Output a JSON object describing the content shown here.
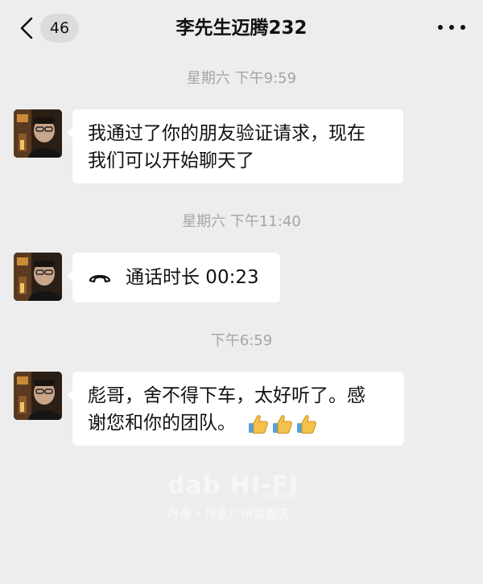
{
  "header": {
    "back_label": "<",
    "unread_count": "46",
    "title": "李先生迈腾232",
    "more_icon": "more-dots-icon"
  },
  "messages": [
    {
      "timestamp": "星期六 下午9:59",
      "type": "text",
      "lines": [
        "我通过了你的朋友验证请求，现在",
        "我们可以开始聊天了"
      ]
    },
    {
      "timestamp": "星期六 下午11:40",
      "type": "call",
      "text": "通话时长 00:23",
      "icon": "phone-hangup-icon"
    },
    {
      "timestamp": "下午6:59",
      "type": "text",
      "lines": [
        "彪哥，舍不得下车，太好听了。感",
        "谢您和你的团队。"
      ],
      "emoji": [
        "thumbs-up",
        "thumbs-up",
        "thumbs-up"
      ]
    }
  ],
  "watermark": {
    "main": "dab HI-FI",
    "mini": "汽车音响",
    "sub": "丹泉 · 丹泉广州旗舰店"
  },
  "colors": {
    "background": "#ededed",
    "bubble": "#ffffff",
    "timestamp": "#a5a5a5",
    "badge": "#dcdcdc"
  }
}
